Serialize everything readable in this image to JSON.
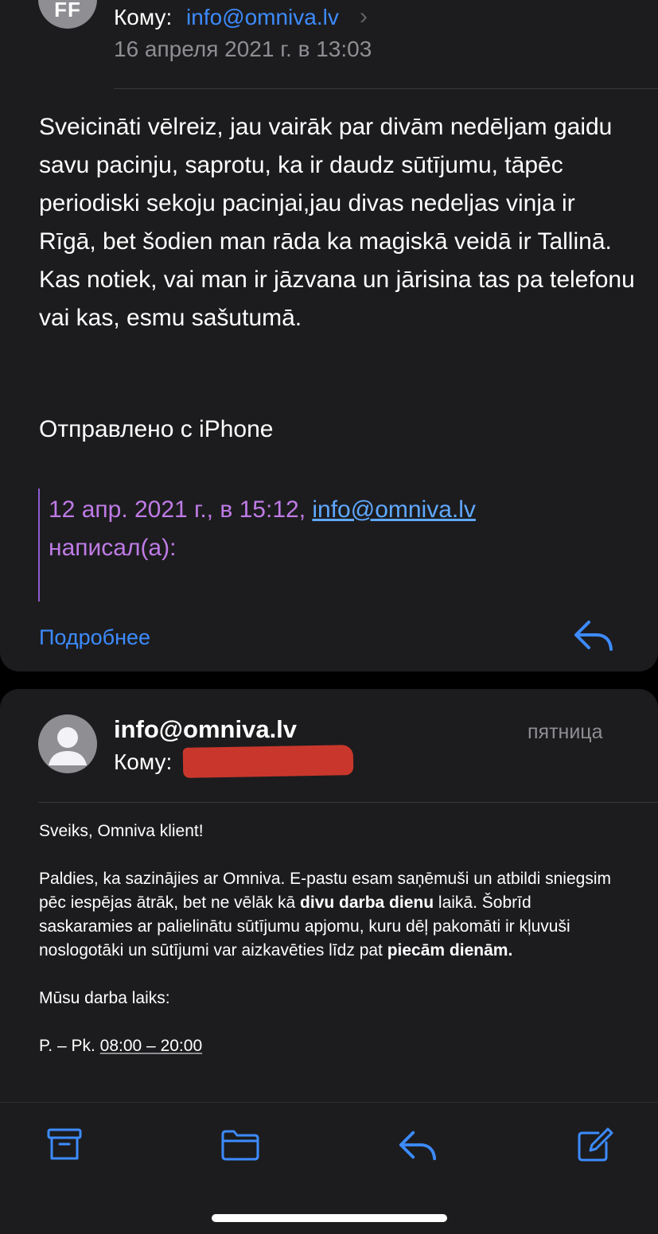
{
  "message1": {
    "avatar_initials": "FF",
    "to_label": "Кому:",
    "to_value": "info@omniva.lv",
    "date": "16 апреля 2021 г. в 13:03",
    "body": "Sveicināti vēlreiz, jau vairāk par divām nedēljam gaidu savu pacinju, saprotu, ka ir daudz sūtījumu, tāpēc periodiski sekoju pacinjai,jau divas nedeljas vinja ir Rīgā, bet šodien man rāda ka magiskā veidā ir Tallinā. Kas notiek, vai man ir jāzvana un jārisina tas pa telefonu vai kas, esmu sašutumā.",
    "signature": "Отправлено с iPhone",
    "quote": {
      "prefix": "12 апр. 2021 г., в 15:12, ",
      "link": "info@omniva.lv",
      "suffix": "написал(а):"
    },
    "more_label": "Подробнее"
  },
  "message2": {
    "from": "info@omniva.lv",
    "day": "пятница",
    "to_label": "Кому:",
    "greeting": "Sveiks, Omniva klient!",
    "para1_a": "Paldies, ka sazinājies ar Omniva. E-pastu esam saņēmuši un atbildi sniegsim pēc iespējas ātrāk, bet ne vēlāk kā ",
    "para1_bold": "divu darba dienu",
    "para1_b": " laikā. Šobrīd saskaramies ar palielinātu sūtījumu apjomu, kuru dēļ pakomāti ir kļuvuši noslogotāki un sūtījumi var aizkavēties līdz pat ",
    "para1_bold2": "piecām dienām.",
    "hours_title": "Mūsu darba laiks:",
    "hours_days": "P. – Pk. ",
    "hours_time": "08:00 – 20:00"
  },
  "toolbar": {
    "icons": [
      "archive-icon",
      "folder-icon",
      "reply-icon",
      "compose-icon"
    ],
    "accent": "#3d8bff"
  },
  "colors": {
    "background": "#000000",
    "card": "#1c1c1e",
    "link": "#3d8bff",
    "quote": "#bf7be6",
    "redaction": "#c9372c"
  }
}
